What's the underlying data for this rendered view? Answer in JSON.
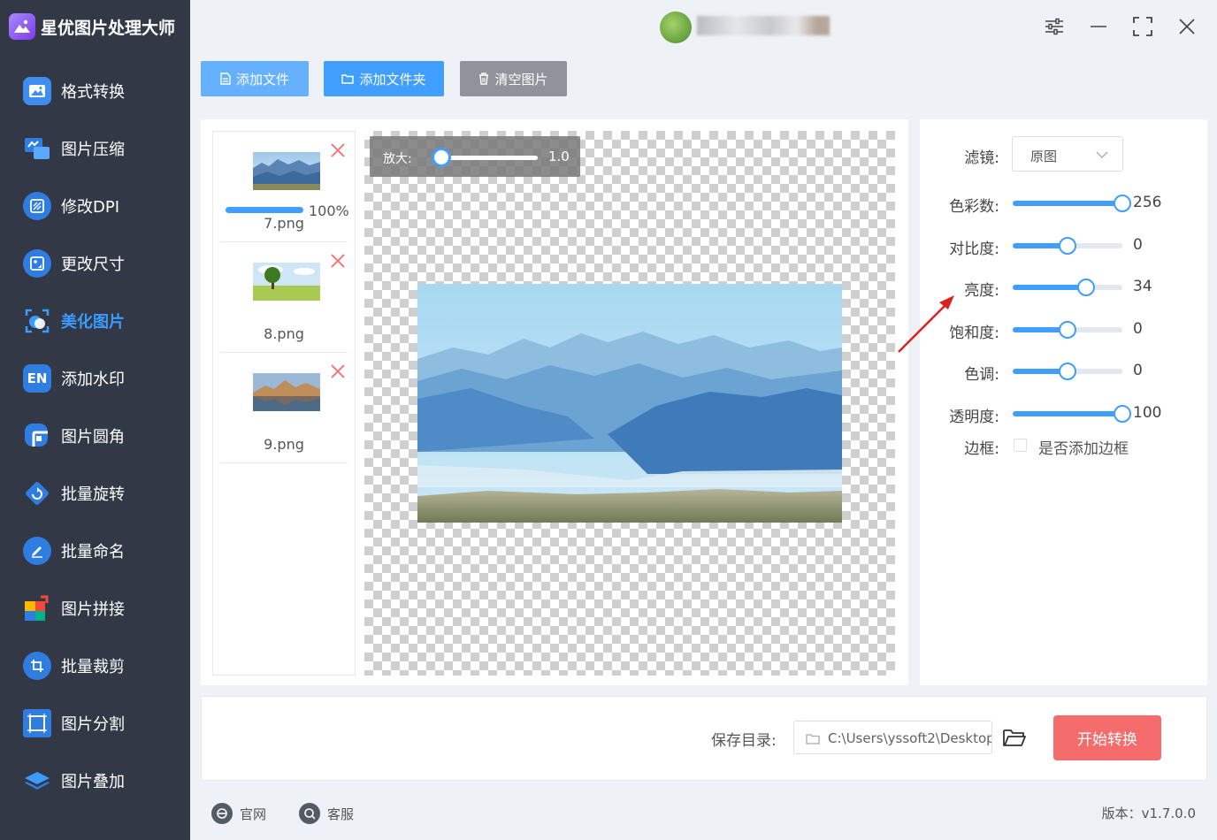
{
  "app": {
    "title": "星优图片处理大师"
  },
  "colors": {
    "sidebar_bg": "#323846",
    "accent": "#409eff",
    "start_button": "#f56c6c",
    "active_nav": "#3b9cff"
  },
  "sidebar": {
    "items": [
      {
        "label": "格式转换",
        "icon": "image-convert-icon",
        "active": false
      },
      {
        "label": "图片压缩",
        "icon": "compress-icon",
        "active": false
      },
      {
        "label": "修改DPI",
        "icon": "dpi-icon",
        "active": false
      },
      {
        "label": "更改尺寸",
        "icon": "resize-icon",
        "active": false
      },
      {
        "label": "美化图片",
        "icon": "beautify-icon",
        "active": true
      },
      {
        "label": "添加水印",
        "icon": "watermark-icon",
        "active": false
      },
      {
        "label": "图片圆角",
        "icon": "rounded-corner-icon",
        "active": false
      },
      {
        "label": "批量旋转",
        "icon": "rotate-icon",
        "active": false
      },
      {
        "label": "批量命名",
        "icon": "rename-icon",
        "active": false
      },
      {
        "label": "图片拼接",
        "icon": "puzzle-icon",
        "active": false
      },
      {
        "label": "批量裁剪",
        "icon": "crop-icon",
        "active": false
      },
      {
        "label": "图片分割",
        "icon": "split-icon",
        "active": false
      },
      {
        "label": "图片叠加",
        "icon": "layers-icon",
        "active": false
      }
    ]
  },
  "toolbar": {
    "add_file": "添加文件",
    "add_folder": "添加文件夹",
    "clear_images": "清空图片"
  },
  "files": [
    {
      "name": "7.png",
      "progress": "100%"
    },
    {
      "name": "8.png"
    },
    {
      "name": "9.png"
    }
  ],
  "preview": {
    "zoom_label": "放大:",
    "zoom_value": "1.0"
  },
  "settings": {
    "filter_label": "滤镜:",
    "filter_value": "原图",
    "sliders": [
      {
        "label": "色彩数:",
        "value": "256",
        "fraction": 1.0
      },
      {
        "label": "对比度:",
        "value": "0",
        "fraction": 0.5
      },
      {
        "label": "亮度:",
        "value": "34",
        "fraction": 0.67
      },
      {
        "label": "饱和度:",
        "value": "0",
        "fraction": 0.5
      },
      {
        "label": "色调:",
        "value": "0",
        "fraction": 0.5
      },
      {
        "label": "透明度:",
        "value": "100",
        "fraction": 1.0
      }
    ],
    "border_label": "边框:",
    "border_checkbox": "是否添加边框"
  },
  "output": {
    "save_label": "保存目录:",
    "path": "C:\\Users\\yssoft2\\Desktop",
    "start_button": "开始转换"
  },
  "footer": {
    "website": "官网",
    "support": "客服",
    "version": "版本：v1.7.0.0"
  }
}
